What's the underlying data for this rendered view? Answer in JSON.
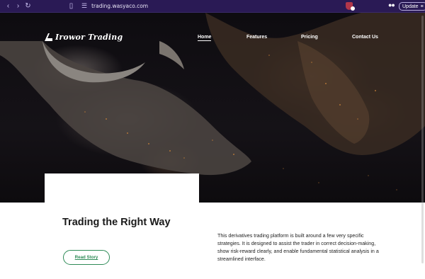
{
  "browser": {
    "back_icon": "chevron-left-icon",
    "forward_icon": "chevron-right-icon",
    "reload_icon": "reload-icon",
    "bookmark_icon": "bookmark-icon",
    "site_info_icon": "site-settings-icon",
    "url": "trading.wasyaco.com",
    "update_label": "Update",
    "colors": {
      "chrome_bg": "#2a1a55"
    }
  },
  "site": {
    "brand": "Irowor Trading",
    "nav": [
      {
        "label": "Home",
        "active": true
      },
      {
        "label": "Features",
        "active": false
      },
      {
        "label": "Pricing",
        "active": false
      },
      {
        "label": "Contact Us",
        "active": false
      }
    ]
  },
  "main": {
    "title": "Trading the Right Way",
    "description": "This derivatives trading platform is built around a few very specific strategies. It is designed to assist the trader in correct decision-making, show risk-reward clearly, and enable fundamental statistical analysis in a streamlined interface.",
    "cta_label": "Read Story",
    "colors": {
      "accent": "#2e8b57"
    }
  }
}
